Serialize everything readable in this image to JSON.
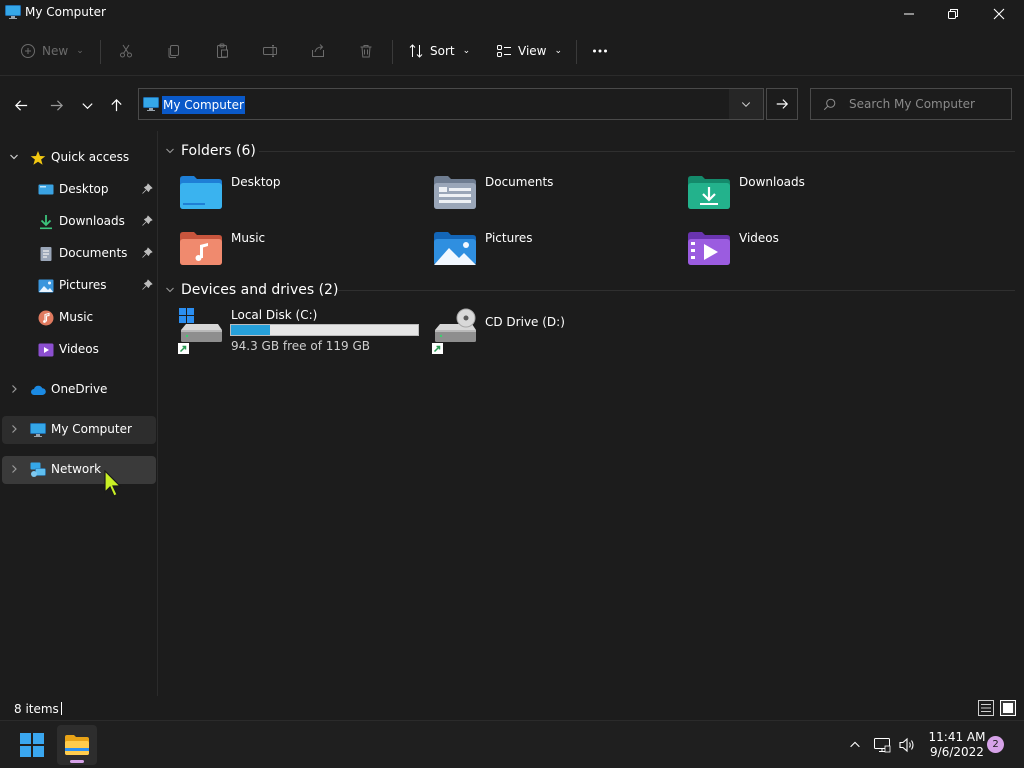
{
  "window": {
    "title": "My Computer"
  },
  "command_bar": {
    "new_label": "New",
    "sort_label": "Sort",
    "view_label": "View"
  },
  "address_bar": {
    "path": "My Computer",
    "search_placeholder": "Search My Computer"
  },
  "sidebar": {
    "quick_access": {
      "label": "Quick access",
      "items": [
        {
          "label": "Desktop",
          "pinned": true,
          "icon": "desktop-icon"
        },
        {
          "label": "Downloads",
          "pinned": true,
          "icon": "downloads-icon"
        },
        {
          "label": "Documents",
          "pinned": true,
          "icon": "documents-icon"
        },
        {
          "label": "Pictures",
          "pinned": true,
          "icon": "pictures-icon"
        },
        {
          "label": "Music",
          "pinned": false,
          "icon": "music-icon"
        },
        {
          "label": "Videos",
          "pinned": false,
          "icon": "videos-icon"
        }
      ]
    },
    "onedrive_label": "OneDrive",
    "my_computer_label": "My Computer",
    "network_label": "Network"
  },
  "content": {
    "folders_header": "Folders (6)",
    "folders": [
      {
        "label": "Desktop",
        "icon": "desktop-folder-icon"
      },
      {
        "label": "Documents",
        "icon": "documents-folder-icon"
      },
      {
        "label": "Downloads",
        "icon": "downloads-folder-icon"
      },
      {
        "label": "Music",
        "icon": "music-folder-icon"
      },
      {
        "label": "Pictures",
        "icon": "pictures-folder-icon"
      },
      {
        "label": "Videos",
        "icon": "videos-folder-icon"
      }
    ],
    "drives_header": "Devices and drives (2)",
    "drives": [
      {
        "label": "Local Disk (C:)",
        "free_text": "94.3 GB free of 119 GB",
        "used_fraction": 0.21
      },
      {
        "label": "CD Drive (D:)"
      }
    ]
  },
  "status_bar": {
    "item_count": "8 items"
  },
  "taskbar": {
    "time": "11:41 AM",
    "date": "9/6/2022",
    "notification_count": "2"
  },
  "colors": {
    "accent": "#0a59c9",
    "background": "#1c1c1c",
    "usage_bar": "#26a0da"
  }
}
